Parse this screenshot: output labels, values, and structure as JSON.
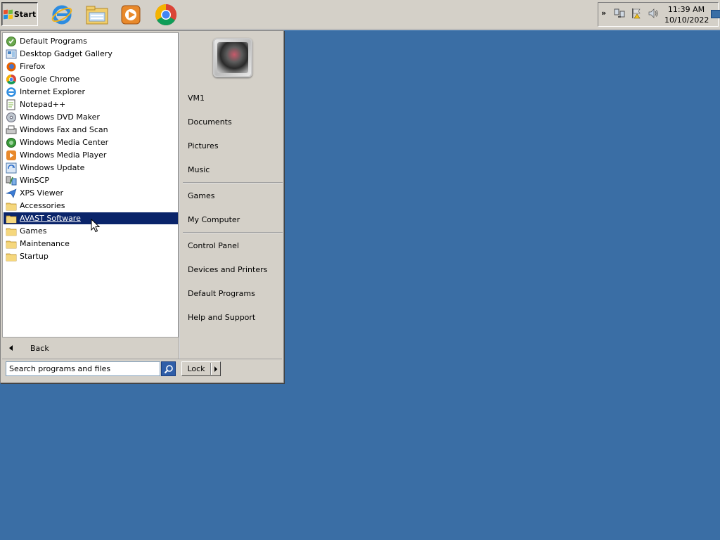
{
  "taskbar": {
    "start_label": "Start",
    "pinned": [
      {
        "name": "internet-explorer-icon"
      },
      {
        "name": "windows-explorer-icon"
      },
      {
        "name": "windows-media-player-icon"
      },
      {
        "name": "google-chrome-icon"
      }
    ],
    "tray": {
      "time": "11:39 AM",
      "date": "10/10/2022"
    }
  },
  "start_menu": {
    "programs": [
      {
        "label": "Default Programs",
        "icon": "default-programs-icon"
      },
      {
        "label": "Desktop Gadget Gallery",
        "icon": "gadget-gallery-icon"
      },
      {
        "label": "Firefox",
        "icon": "firefox-icon"
      },
      {
        "label": "Google Chrome",
        "icon": "chrome-icon"
      },
      {
        "label": "Internet Explorer",
        "icon": "internet-explorer-icon"
      },
      {
        "label": "Notepad++",
        "icon": "notepad-plus-plus-icon"
      },
      {
        "label": "Windows DVD Maker",
        "icon": "dvd-maker-icon"
      },
      {
        "label": "Windows Fax and Scan",
        "icon": "fax-scan-icon"
      },
      {
        "label": "Windows Media Center",
        "icon": "media-center-icon"
      },
      {
        "label": "Windows Media Player",
        "icon": "media-player-icon"
      },
      {
        "label": "Windows Update",
        "icon": "windows-update-icon"
      },
      {
        "label": "WinSCP",
        "icon": "winscp-icon"
      },
      {
        "label": "XPS Viewer",
        "icon": "xps-viewer-icon"
      },
      {
        "label": "Accessories",
        "icon": "folder-icon"
      },
      {
        "label": "AVAST Software",
        "icon": "folder-icon",
        "selected": true
      },
      {
        "label": "Games",
        "icon": "folder-icon"
      },
      {
        "label": "Maintenance",
        "icon": "folder-icon"
      },
      {
        "label": "Startup",
        "icon": "folder-icon"
      }
    ],
    "back_label": "Back",
    "search_placeholder": "Search programs and files",
    "places": [
      {
        "label": "VM1"
      },
      {
        "label": "Documents"
      },
      {
        "label": "Pictures"
      },
      {
        "label": "Music"
      },
      {
        "label": "Games"
      },
      {
        "label": "My Computer"
      },
      {
        "label": "Control Panel"
      },
      {
        "label": "Devices and Printers"
      },
      {
        "label": "Default Programs"
      },
      {
        "label": "Help and Support"
      }
    ],
    "lock_label": "Lock"
  },
  "colors": {
    "desktop": "#3a6ea5",
    "chrome_gray": "#d4d0c8",
    "selection": "#0a246a"
  }
}
